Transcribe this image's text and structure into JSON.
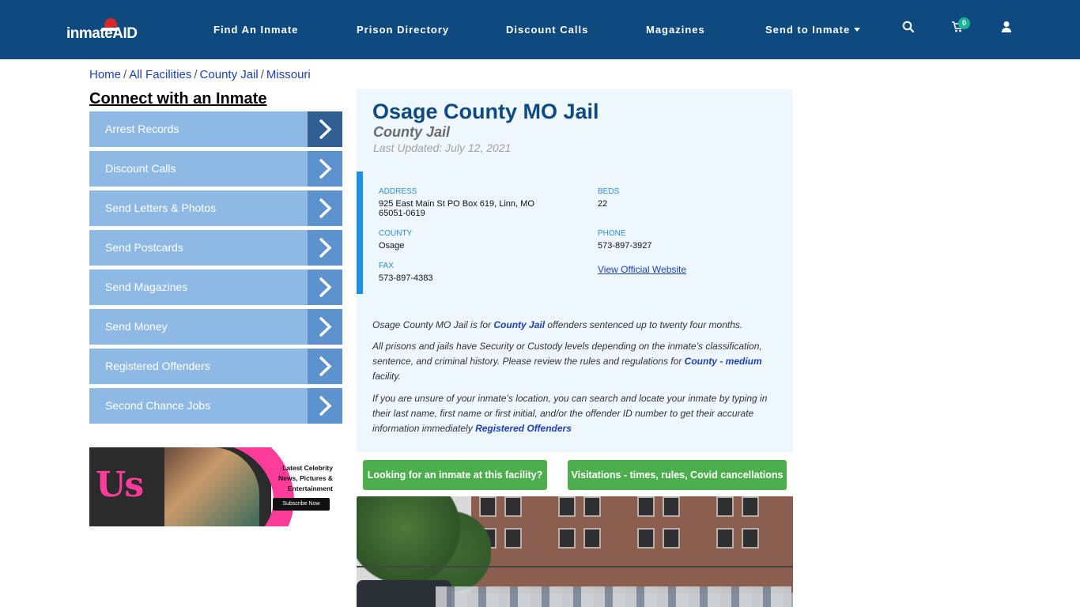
{
  "header": {
    "logo": "inmateAID",
    "nav": [
      {
        "label": "Find An Inmate"
      },
      {
        "label": "Prison Directory"
      },
      {
        "label": "Discount Calls"
      },
      {
        "label": "Magazines"
      },
      {
        "label": "Send to Inmate"
      }
    ],
    "cart_count": "0",
    "icons": [
      "search-icon",
      "cart-icon",
      "user-icon",
      "chevron-down-icon"
    ]
  },
  "breadcrumb": [
    {
      "label": "Home"
    },
    {
      "label": "All Facilities"
    },
    {
      "label": "County Jail"
    },
    {
      "label": "Missouri"
    }
  ],
  "breadcrumb_sep": "/",
  "sidebar": {
    "heading": "Connect with an Inmate",
    "items": [
      {
        "label": "Arrest Records"
      },
      {
        "label": "Discount Calls"
      },
      {
        "label": "Send Letters & Photos"
      },
      {
        "label": "Send Postcards"
      },
      {
        "label": "Send Magazines"
      },
      {
        "label": "Send Money"
      },
      {
        "label": "Registered Offenders"
      },
      {
        "label": "Second Chance Jobs"
      }
    ]
  },
  "ad": {
    "brand": "Us",
    "copy": "Latest Celebrity News, Pictures & Entertainment",
    "cta": "Subscribe Now",
    "colors": {
      "accent": "#ff3c9a"
    }
  },
  "facility": {
    "title": "Osage County MO Jail",
    "type": "County Jail",
    "updated": "Last Updated: July 12, 2021",
    "address_label": "ADDRESS",
    "address": "925 East Main St PO Box 619, Linn, MO 65051-0619",
    "beds_label": "BEDS",
    "beds": "22",
    "county_label": "COUNTY",
    "county": "Osage",
    "phone_label": "PHONE",
    "phone": "573-897-3927",
    "fax_label": "FAX",
    "fax": "573-897-4383",
    "website_link": "View Official Website"
  },
  "description": {
    "p1_a": "Osage County MO Jail is for ",
    "p1_link": "County Jail",
    "p1_b": " offenders sentenced up to twenty four months.",
    "p2_a": "All prisons and jails have Security or Custody levels depending on the inmate’s classification, sentence, and criminal history. Please review the rules and regulations for ",
    "p2_link": "County - medium",
    "p2_b": " facility.",
    "p3_a": "If you are unsure of your inmate’s location, you can search and locate your inmate by typing in their last name, first name or first initial, and/or the offender ID number to get their accurate information immediately ",
    "p3_link": "Registered Offenders"
  },
  "buttons": {
    "looking": "Looking for an inmate at this facility?",
    "visitations": "Visitations - times, rules, Covid cancellations"
  },
  "colors": {
    "header_bg": "#0e4a7f",
    "sidebar_item": "#8fb9e5",
    "sidebar_arrow": "#5d92cc",
    "card_bg": "#eef7fd",
    "button_green": "#4cae4c",
    "link_blue": "#1d3fb8"
  }
}
